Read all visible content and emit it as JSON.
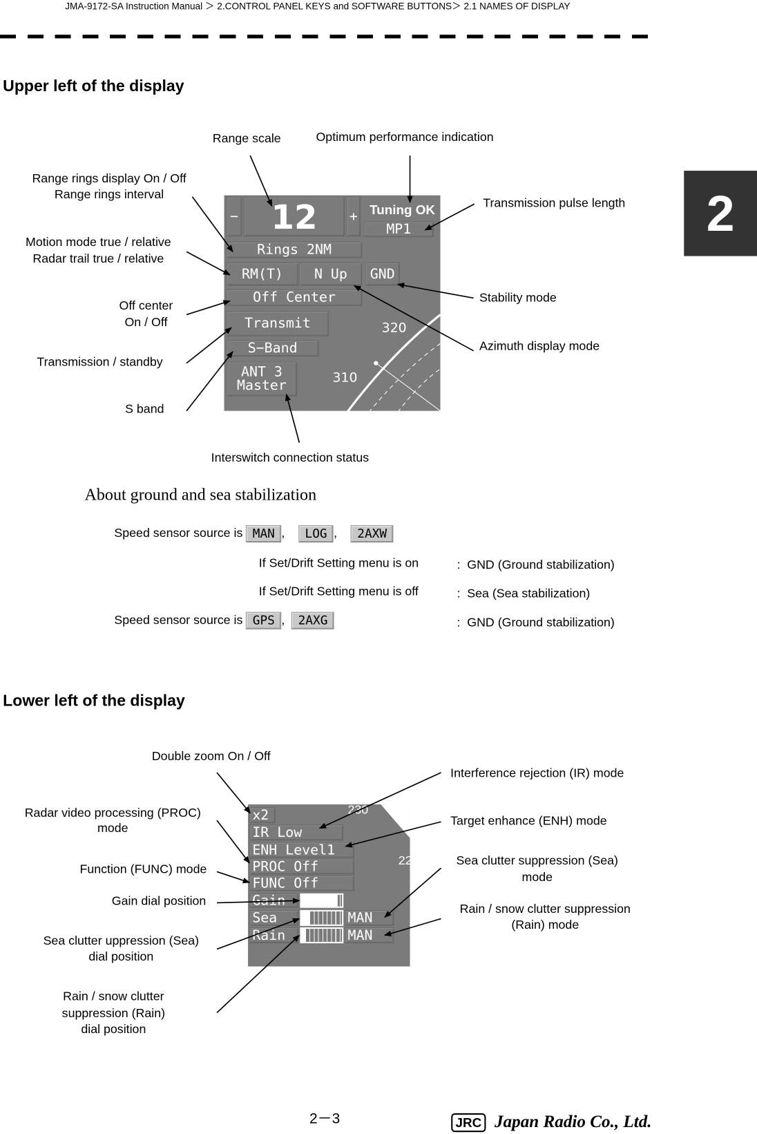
{
  "header": {
    "breadcrumb": "JMA-9172-SA Instruction Manual ＞ 2.CONTROL PANEL KEYS and SOFTWARE BUTTONS＞ 2.1  NAMES OF DISPLAY"
  },
  "chapter_tab": "2",
  "upper": {
    "title": "Upper left of the display",
    "labels": {
      "range_scale": "Range scale",
      "optimum": "Optimum performance  indication",
      "rings_1": "Range rings display On  / Off",
      "rings_2": "Range rings interval",
      "pulse": "Transmission pulse length",
      "motion_1": "Motion mode true / relative",
      "motion_2": "Radar trail true / relative",
      "off_1": "Off center",
      "off_2": "On / Off",
      "stability": "Stability mode",
      "tx": "Transmission / standby",
      "azimuth": "Azimuth display mode",
      "sband": "S band",
      "interswitch": "Interswitch connection status"
    },
    "panel": {
      "minus": "−",
      "range": "12",
      "plus": "+",
      "tuning": "Tuning OK",
      "pulse": "MP1",
      "rings": "Rings 2NM",
      "motion": "RM(T)",
      "azimuth": "N Up",
      "stab": "GND",
      "offcenter": "Off Center",
      "transmit": "Transmit",
      "band": "S−Band",
      "ant_1": "ANT 3",
      "ant_2": "Master",
      "bearing_320": "320",
      "bearing_310": "310"
    }
  },
  "stabilization": {
    "title": "About ground and sea stabilization",
    "row1_prefix": "Speed sensor source is",
    "row1_keys": [
      "MAN",
      "LOG",
      "2AXW"
    ],
    "cond_on": "If Set/Drift Setting menu is on",
    "res_on": "GND (Ground stabilization)",
    "cond_off": "If Set/Drift Setting menu is off",
    "res_off": "Sea (Sea stabilization)",
    "row2_prefix": "Speed sensor source is",
    "row2_keys": [
      "GPS",
      "2AXG"
    ],
    "res_row2": "GND (Ground stabilization)",
    "colon": ":",
    "comma": ","
  },
  "lower": {
    "title": "Lower left of the display",
    "labels": {
      "zoom": "Double zoom On / Off",
      "ir": "Interference rejection (IR) mode",
      "proc_1": "Radar video processing (PROC)",
      "proc_2": "mode",
      "enh": "Target enhance (ENH) mode",
      "func": "Function (FUNC) mode",
      "seamode_1": "Sea clutter suppression (Sea)",
      "seamode_2": "mode",
      "gain": "Gain dial position",
      "rainmode_1": "Rain / snow clutter suppression",
      "rainmode_2": "(Rain) mode",
      "seadial_1": "Sea clutter uppression (Sea)",
      "seadial_2": "dial position",
      "raindial_1": "Rain / snow clutter",
      "raindial_2": "suppression (Rain)",
      "raindial_3": "dial position"
    },
    "panel": {
      "zoom": "x2",
      "ir": "IR Low",
      "enh": "ENH Level1",
      "proc": "PROC Off",
      "func": "FUNC Off",
      "gain": "Gain",
      "sea": "Sea",
      "rain": "Rain",
      "sea_mode": "MAN",
      "rain_mode": "MAN",
      "bearing_230": "230",
      "bearing_22": "22",
      "gain_level_pct": 90,
      "sea_level_pct": 20,
      "rain_level_pct": 10
    }
  },
  "footer": {
    "page": "2－3",
    "logo": "JRC Japan Radio Co., Ltd."
  }
}
